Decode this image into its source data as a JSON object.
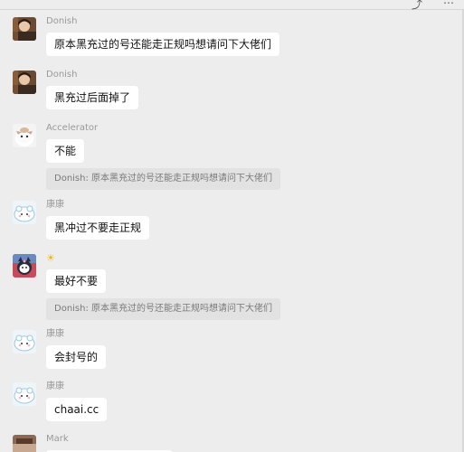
{
  "messages": [
    {
      "sender": "Donish",
      "text": "原本黑充过的号还能走正规吗想请问下大佬们",
      "quote": "",
      "avatar": "donish-avatar"
    },
    {
      "sender": "Donish",
      "text": "黑充过后面掉了",
      "quote": "",
      "avatar": "donish-avatar"
    },
    {
      "sender": "Accelerator",
      "text": "不能",
      "quote": "Donish: 原本黑充过的号还能走正规吗想请问下大佬们",
      "avatar": "cat-avatar"
    },
    {
      "sender": "康康",
      "text": "黑冲过不要走正规",
      "quote": "",
      "avatar": "cloud-character-avatar"
    },
    {
      "sender": "",
      "text": "最好不要",
      "quote": "Donish: 原本黑充过的号还能走正规吗想请问下大佬们",
      "avatar": "kuromi-avatar",
      "sender_icon": "sun-icon"
    },
    {
      "sender": "康康",
      "text": "会封号的",
      "quote": "",
      "avatar": "cloud-character-avatar"
    },
    {
      "sender": "康康",
      "text": "chaai.cc",
      "quote": "",
      "avatar": "cloud-character-avatar"
    },
    {
      "sender": "Mark",
      "text": "",
      "quote": "",
      "avatar": "mark-avatar"
    }
  ],
  "colors": {
    "background": "#ededed",
    "bubble": "#ffffff",
    "quote_bg": "#e2e2e2",
    "sender_text": "#999999"
  }
}
